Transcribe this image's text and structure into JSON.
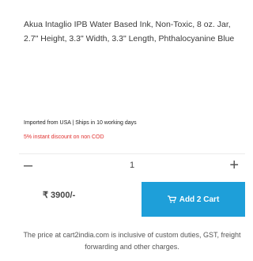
{
  "product": {
    "title": "Akua Intaglio IPB Water Based Ink, Non-Toxic, 8 oz. Jar, 2.7\" Height, 3.3\" Width, 3.3\" Length, Phthalocyanine Blue",
    "imported_text": "Imported from USA | Ships in 10 working days",
    "discount_text": "5% instant discount on non COD",
    "price": "₹ 3900/-"
  },
  "quantity": {
    "minus_label": "–",
    "value": "1",
    "plus_label": "+"
  },
  "cart_button": {
    "label": "Add 2 Cart",
    "icon": "shopping-cart-icon"
  },
  "footer_note": "The price at cart2india.com is inclusive of custom duties, GST, freight forwarding and other charges.",
  "colors": {
    "accent": "#1e9fd9",
    "discount": "#e0312f"
  }
}
